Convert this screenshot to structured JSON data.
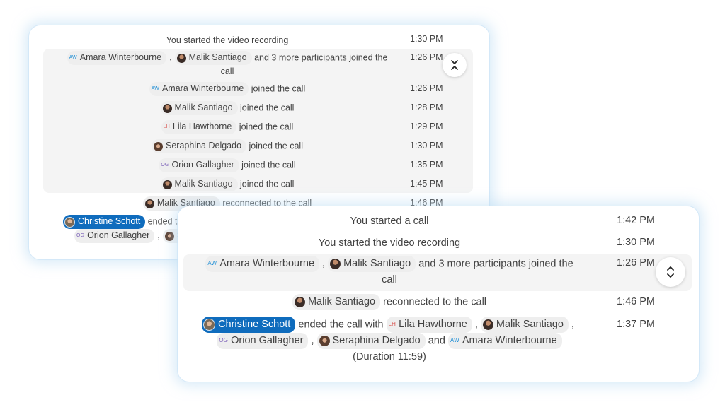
{
  "back_panel": {
    "rows": [
      {
        "text": "You started the video recording",
        "time": "1:30 PM"
      },
      {
        "p1": "Amara Winterbourne",
        "p1_initials": "AW",
        "p2": "Malik Santiago",
        "text": "and 3 more participants joined the",
        "text2": "call",
        "time": "1:26 PM"
      },
      {
        "name": "Amara Winterbourne",
        "initials": "AW",
        "text": "joined the call",
        "time": "1:26 PM"
      },
      {
        "name": "Malik Santiago",
        "text": "joined the call",
        "time": "1:28 PM"
      },
      {
        "name": "Lila Hawthorne",
        "initials": "LH",
        "text": "joined the call",
        "time": "1:29 PM"
      },
      {
        "name": "Seraphina Delgado",
        "text": "joined the call",
        "time": "1:30 PM"
      },
      {
        "name": "Orion Gallagher",
        "initials": "OG",
        "text": "joined the call",
        "time": "1:35 PM"
      },
      {
        "name": "Malik Santiago",
        "text": "joined the call",
        "time": "1:45 PM"
      },
      {
        "name": "Malik Santiago",
        "text": "reconnected to the call",
        "time": "1:46 PM"
      },
      {
        "self": "Christine Schott",
        "text": "ended th",
        "p1": "Orion Gallagher",
        "p1_initials": "OG",
        "p2": "Se"
      }
    ],
    "toggle_label": "Collapse"
  },
  "front_panel": {
    "rows": [
      {
        "text": "You started a call",
        "time": "1:42 PM"
      },
      {
        "text": "You started the video recording",
        "time": "1:30 PM"
      },
      {
        "p1": "Amara Winterbourne",
        "p1_initials": "AW",
        "p2": "Malik Santiago",
        "text": "and 3 more participants joined the",
        "text2": "call",
        "time": "1:26 PM"
      },
      {
        "name": "Malik Santiago",
        "text": "reconnected to the call",
        "time": "1:46 PM"
      },
      {
        "self": "Christine Schott",
        "text": "ended the call with",
        "p_lila": "Lila Hawthorne",
        "lila_initials": "LH",
        "p_malik": "Malik Santiago",
        "p_orion": "Orion Gallagher",
        "orion_initials": "OG",
        "p_sera": "Seraphina Delgado",
        "and": "and",
        "p_amara": "Amara Winterbourne",
        "amara_initials": "AW",
        "duration": "(Duration 11:59)",
        "time": "1:37 PM"
      }
    ],
    "toggle_label": "Expand"
  },
  "colors": {
    "self_chip": "#0f6cbd",
    "aw": "#1f8fd6",
    "lh": "#d9534f",
    "og": "#7a5fb8",
    "group_bg": "#f4f4f4"
  },
  "separator": ","
}
